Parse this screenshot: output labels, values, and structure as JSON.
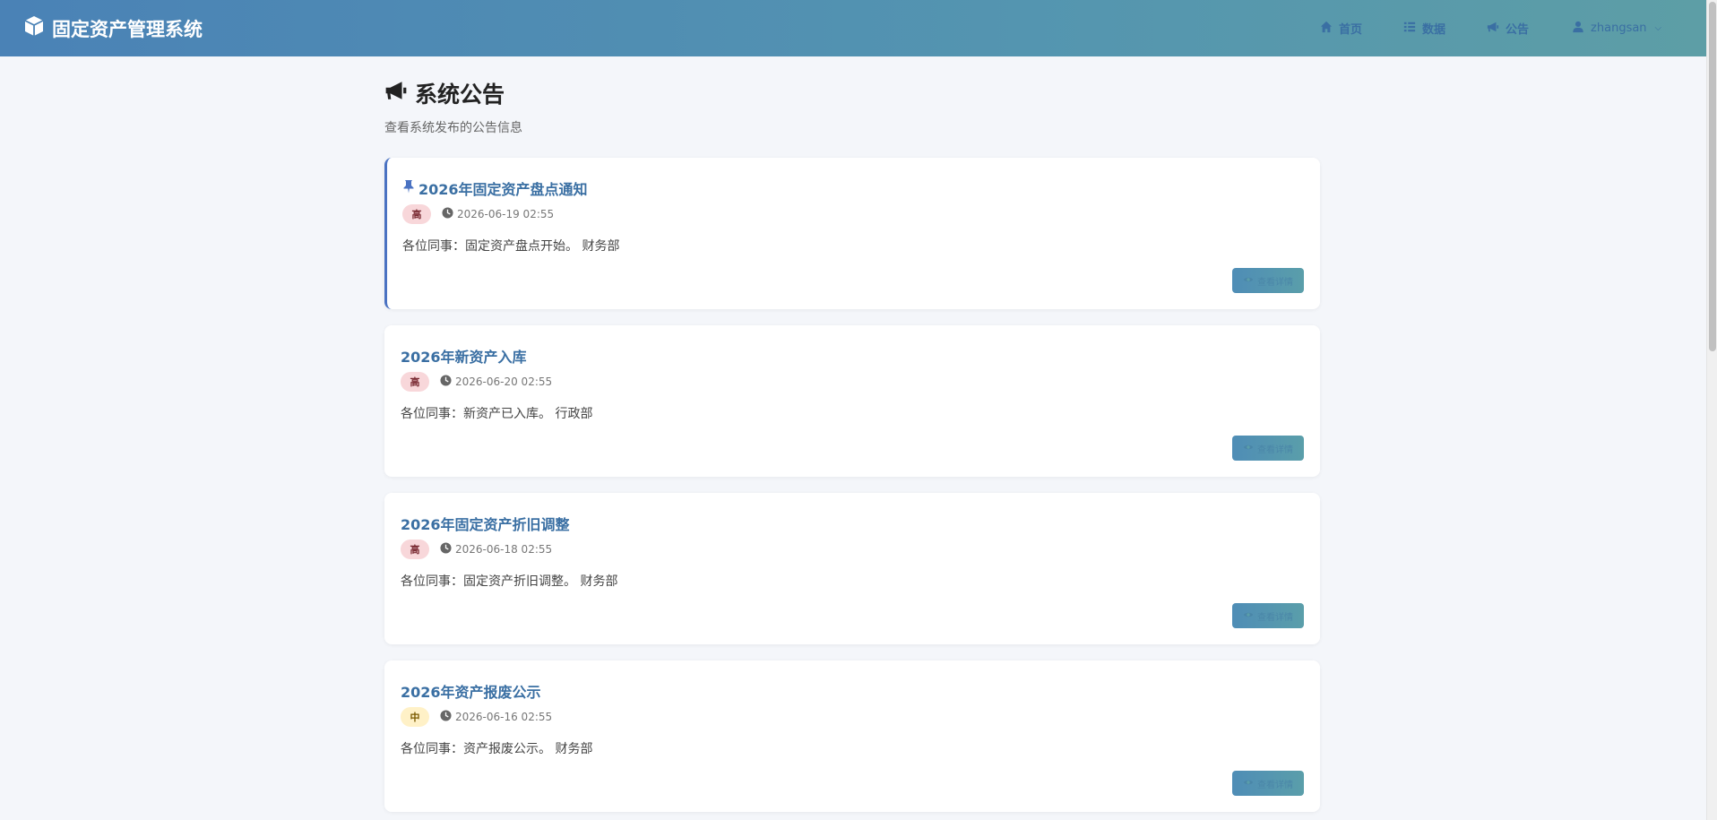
{
  "header": {
    "brand": "固定资产管理系统",
    "nav": {
      "home": "首页",
      "data": "数据",
      "notice": "公告",
      "user": "zhangsan"
    }
  },
  "page": {
    "title": "系统公告",
    "subtitle": "查看系统发布的公告信息"
  },
  "notices": [
    {
      "title": "2026年固定资产盘点通知",
      "pinned": true,
      "priority": "高",
      "time": "2026-06-19 02:55",
      "content": "各位同事：固定资产盘点开始。 财务部",
      "button": "查看详情"
    },
    {
      "title": "2026年新资产入库",
      "pinned": false,
      "priority": "高",
      "time": "2026-06-20 02:55",
      "content": "各位同事：新资产已入库。 行政部",
      "button": "查看详情"
    },
    {
      "title": "2026年固定资产折旧调整",
      "pinned": false,
      "priority": "高",
      "time": "2026-06-18 02:55",
      "content": "各位同事：固定资产折旧调整。 财务部",
      "button": "查看详情"
    },
    {
      "title": "2026年资产报废公示",
      "pinned": false,
      "priority": "中",
      "time": "2026-06-16 02:55",
      "content": "各位同事：资产报废公示。 财务部",
      "button": "查看详情"
    }
  ],
  "colors": {
    "header_gradient_start": "#4a82b6",
    "header_gradient_end": "#5d9ea6",
    "title_blue": "#3a6fa3",
    "pinned_border": "#4a72c2",
    "badge_high_bg": "#f8d7da",
    "badge_mid_bg": "#fff1c7"
  },
  "icons": {
    "brand": "cube-icon",
    "home": "home-icon",
    "data": "list-icon",
    "notice": "bullhorn-icon",
    "user": "user-icon",
    "pin": "pin-icon",
    "clock": "clock-icon",
    "eye": "eye-icon"
  }
}
